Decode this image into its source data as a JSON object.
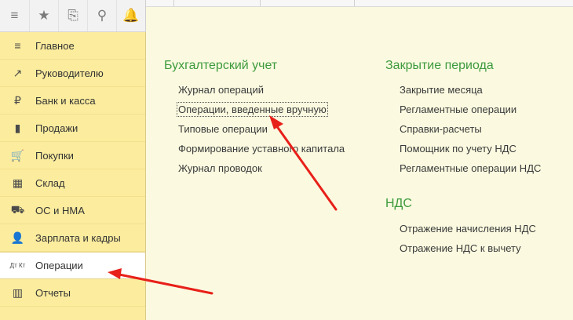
{
  "toolbar": {
    "buttons": [
      {
        "name": "menu-icon",
        "glyph": "≡"
      },
      {
        "name": "star-icon",
        "glyph": "★"
      },
      {
        "name": "history-icon",
        "glyph": "⎘"
      },
      {
        "name": "search-icon",
        "glyph": "⚲"
      },
      {
        "name": "bell-icon",
        "glyph": "🔔"
      }
    ]
  },
  "sidebar": {
    "items": [
      {
        "label": "Главное",
        "icon": "menu-icon",
        "glyph": "≡"
      },
      {
        "label": "Руководителю",
        "icon": "trend-icon",
        "glyph": "↗"
      },
      {
        "label": "Банк и касса",
        "icon": "ruble-icon",
        "glyph": "₽"
      },
      {
        "label": "Продажи",
        "icon": "bag-icon",
        "glyph": "▮"
      },
      {
        "label": "Покупки",
        "icon": "cart-icon",
        "glyph": "🛒"
      },
      {
        "label": "Склад",
        "icon": "warehouse-icon",
        "glyph": "▦"
      },
      {
        "label": "ОС и НМА",
        "icon": "truck-icon",
        "glyph": "⛟"
      },
      {
        "label": "Зарплата и кадры",
        "icon": "person-icon",
        "glyph": "👤"
      },
      {
        "label": "Операции",
        "icon": "dt-kt-icon",
        "glyph": "Дт Кт",
        "active": true
      },
      {
        "label": "Отчеты",
        "icon": "bar-chart-icon",
        "glyph": "▥"
      }
    ]
  },
  "sections": {
    "accounting": {
      "title": "Бухгалтерский учет",
      "links": [
        "Журнал операций",
        "Операции, введенные вручную",
        "Типовые операции",
        "Формирование уставного капитала",
        "Журнал проводок"
      ]
    },
    "closing": {
      "title": "Закрытие периода",
      "links": [
        "Закрытие месяца",
        "Регламентные операции",
        "Справки-расчеты",
        "Помощник по учету НДС",
        "Регламентные операции НДС"
      ]
    },
    "vat": {
      "title": "НДС",
      "links": [
        "Отражение начисления НДС",
        "Отражение НДС к вычету"
      ]
    }
  },
  "colors": {
    "accent": "#3d9a3d",
    "annotation": "#e8201a",
    "sidebar": "#fbec9e"
  }
}
